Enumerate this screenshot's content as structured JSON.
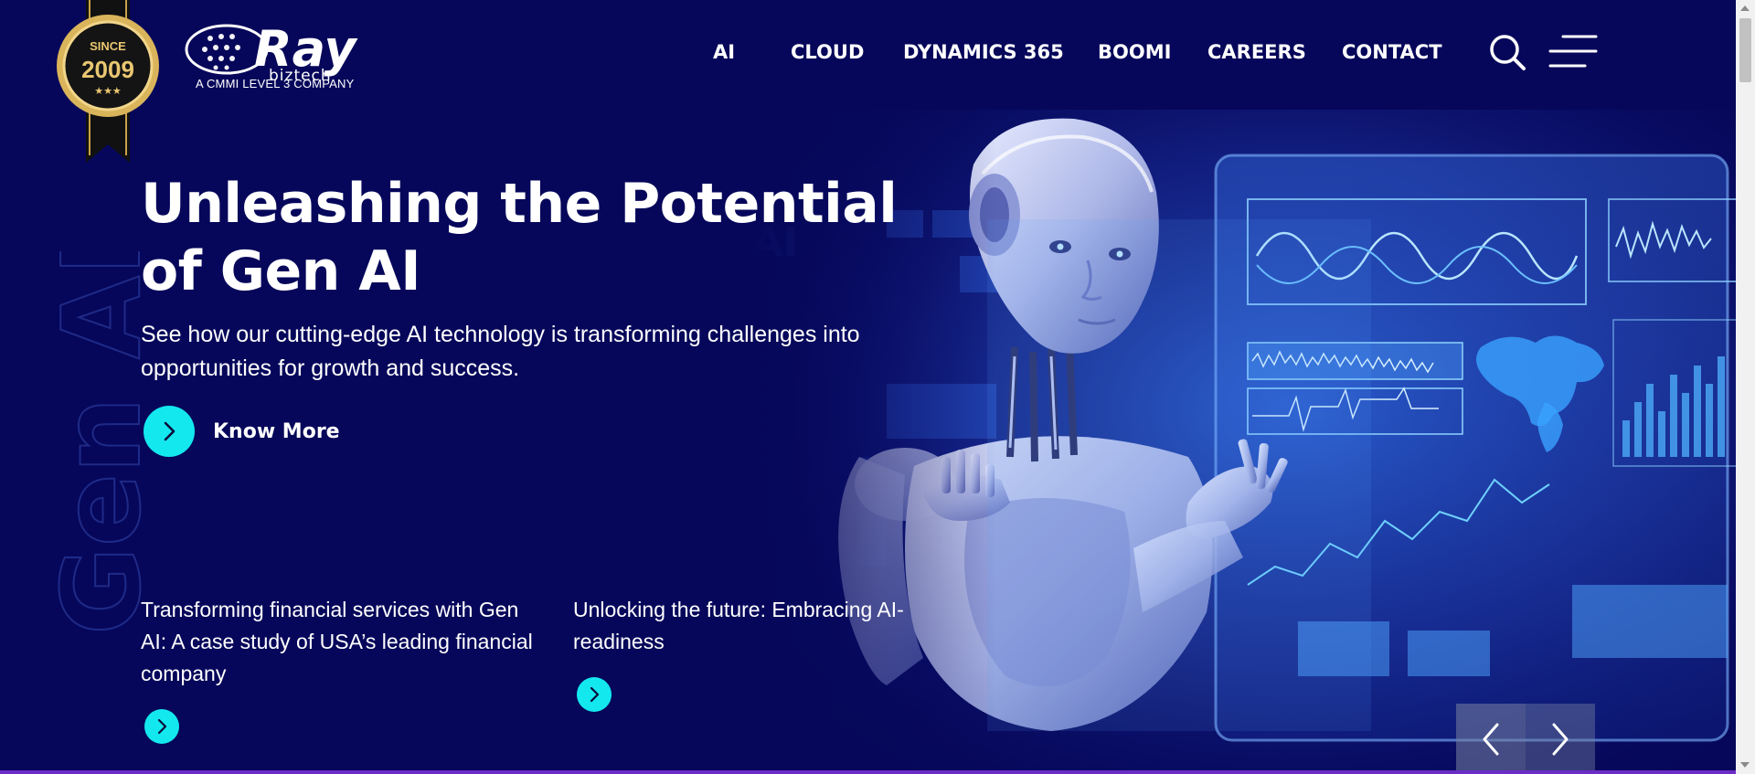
{
  "badge": {
    "since_label": "SINCE",
    "year": "2009"
  },
  "logo": {
    "brand": "Ray",
    "sub": "biztech",
    "tagline": "A CMMI LEVEL 3 COMPANY"
  },
  "nav": {
    "items": [
      "AI",
      "CLOUD",
      "DYNAMICS 365",
      "BOOMI",
      "CAREERS",
      "CONTACT"
    ]
  },
  "header_icons": {
    "search": "search-icon",
    "menu": "hamburger-menu-icon"
  },
  "hero": {
    "watermark": "Gen AI",
    "title": "Unleashing the Potential of Gen AI",
    "subtitle": "See how our cutting-edge AI technology is transforming challenges into opportunities for growth and success.",
    "cta_label": "Know More",
    "screen_overlay_text": "Gen AI"
  },
  "cards": [
    {
      "title": "Transforming financial services with Gen AI: A case study of USA’s leading financial company"
    },
    {
      "title": "Unlocking the future: Embracing AI-readiness"
    }
  ],
  "slider": {
    "prev_icon": "chevron-left-icon",
    "next_icon": "chevron-right-icon"
  },
  "colors": {
    "background": "#06075a",
    "accent_cyan": "#13e8ef",
    "text": "#ffffff",
    "badge_gold": "#d9b45a",
    "bottom_line": "#6c2cc6"
  }
}
